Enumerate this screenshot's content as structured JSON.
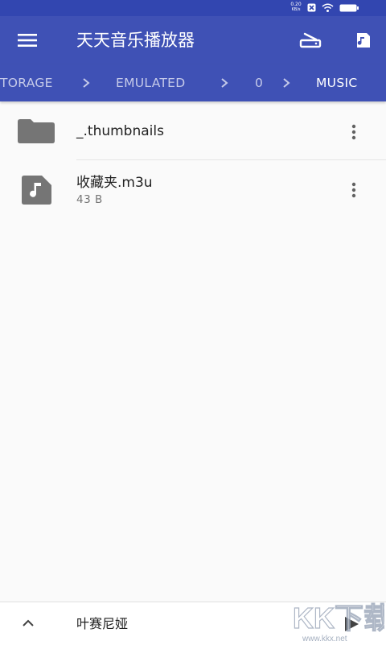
{
  "status_bar": {
    "net_speed": "0.20",
    "net_speed_unit": "KB/s",
    "bg_color": "#3246b0"
  },
  "toolbar": {
    "title": "天天音乐播放器",
    "menu_icon": "menu-icon",
    "storage_icon": "storage-icon",
    "music_icon": "music-note-icon",
    "bg_color": "#3f51b5"
  },
  "breadcrumb": {
    "items": [
      {
        "label": "TORAGE"
      },
      {
        "label": "EMULATED"
      },
      {
        "label": "0"
      },
      {
        "label": "MUSIC"
      }
    ],
    "separator_icon": "chevron-right-icon",
    "inactive_color": "#c5cae9",
    "active_color": "#ffffff"
  },
  "files": [
    {
      "name": "_.thumbnails",
      "subtitle": "",
      "icon": "folder-icon"
    },
    {
      "name": "收藏夹.m3u",
      "subtitle": "43 B",
      "icon": "music-file-icon"
    }
  ],
  "player": {
    "track": "叶赛尼娅",
    "expand_icon": "chevron-up-icon",
    "play_icon": "play-icon"
  },
  "watermark": {
    "logo_text": "KK下载",
    "url": "www.kkx.net"
  }
}
